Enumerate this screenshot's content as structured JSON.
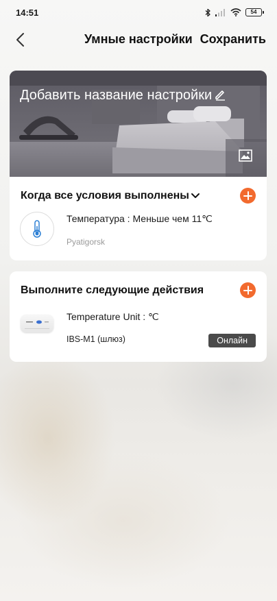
{
  "status_bar": {
    "time": "14:51",
    "battery": "54",
    "icons": [
      "bluetooth-icon",
      "signal-icon",
      "wifi-icon",
      "battery-icon"
    ]
  },
  "header": {
    "title": "Умные настройки",
    "save_label": "Сохранить",
    "back_icon": "back-arrow-icon"
  },
  "hero": {
    "name_placeholder": "Добавить название настройки",
    "edit_icon": "pencil-icon",
    "image_icon": "image-icon"
  },
  "conditions": {
    "title": "Когда все условия выполнены",
    "items": [
      {
        "icon": "thermometer-icon",
        "label": "Температура : Меньше чем 11℃",
        "location": "Pyatigorsk"
      }
    ]
  },
  "actions": {
    "title": "Выполните следующие действия",
    "items": [
      {
        "icon": "gateway-device-icon",
        "label": "Temperature Unit : ℃",
        "device": "IBS-M1 (шлюз)",
        "status": "Онлайн"
      }
    ]
  },
  "colors": {
    "accent": "#f26a2e",
    "badge": "#4a4a4a"
  }
}
